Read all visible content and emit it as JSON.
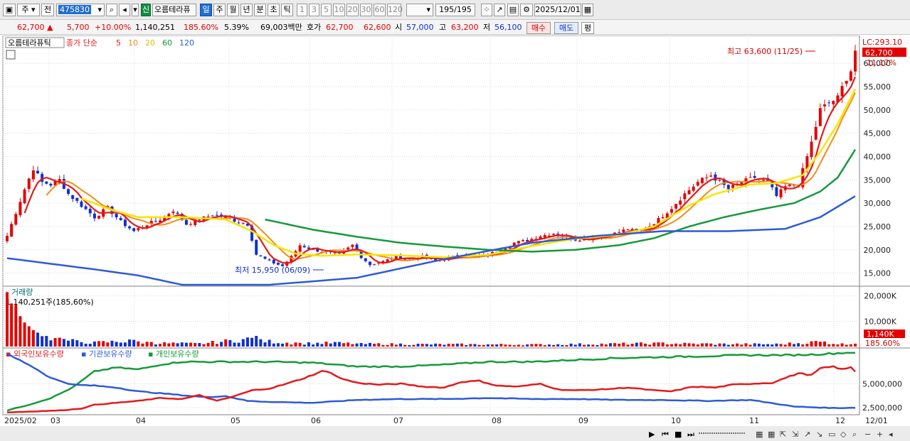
{
  "toolbar": {
    "period_type": "주",
    "scope": "전",
    "code": "475830",
    "badge": "신",
    "name": "오름테라퓨",
    "periods": [
      "일",
      "주",
      "월",
      "년",
      "분",
      "초",
      "틱"
    ],
    "active_period": "일",
    "intervals": [
      "1",
      "3",
      "5",
      "10",
      "20",
      "30",
      "60",
      "120"
    ],
    "count": "195/195",
    "date": "2025/12/01"
  },
  "quote": {
    "price": "62,700",
    "change": "5,700",
    "change_pct": "+10.00%",
    "volume": "1,140,251",
    "volume_ratio": "185.60%",
    "turnover": "5.39%",
    "value": "69,003백만",
    "hoga_label": "호가",
    "ask": "62,700",
    "bid": "62,600",
    "open_label": "시",
    "open": "57,000",
    "high_label": "고",
    "high": "63,200",
    "low_label": "저",
    "low": "56,100",
    "buy_label": "매수",
    "sell_label": "매도",
    "eval_label": "평"
  },
  "colors": {
    "up": "#e30000",
    "down": "#1030d0",
    "ma5": "#e31a1c",
    "ma10": "#f28c1b",
    "ma20": "#f5e600",
    "ma60": "#169a3a",
    "ma120": "#2e5bd6"
  },
  "chart_data": [
    {
      "type": "candlestick",
      "legend": {
        "name": "오름테라퓨틱",
        "label": "종가 단순",
        "periods": [
          "5",
          "10",
          "20",
          "60",
          "120"
        ]
      },
      "x_ticks": [
        "2025/02",
        "03",
        "04",
        "05",
        "06",
        "07",
        "08",
        "09",
        "10",
        "11",
        "12",
        "12/01"
      ],
      "y_ticks": [
        60000,
        55000,
        50000,
        45000,
        40000,
        35000,
        30000,
        25000,
        20000,
        15000
      ],
      "y_tick_labels": [
        "60,000",
        "55,000",
        "50,000",
        "45,000",
        "40,000",
        "35,000",
        "30,000",
        "25,000",
        "20,000",
        "15,000"
      ],
      "ylim": [
        12500,
        65500
      ],
      "lc_label": "LC:293.10",
      "last_price_label": "62,700",
      "last_pct_label": "11.17%",
      "annotations": {
        "high": "최고 63,600 (11/25)",
        "low": "최저 15,950 (06/09)"
      },
      "anchors": [
        [
          0,
          23000
        ],
        [
          2,
          28000
        ],
        [
          4,
          33000
        ],
        [
          6,
          37500
        ],
        [
          8,
          34500
        ],
        [
          10,
          34000
        ],
        [
          12,
          35000
        ],
        [
          14,
          32000
        ],
        [
          17,
          29500
        ],
        [
          20,
          27000
        ],
        [
          23,
          29000
        ],
        [
          26,
          26000
        ],
        [
          29,
          24000
        ],
        [
          32,
          25500
        ],
        [
          35,
          26500
        ],
        [
          38,
          28500
        ],
        [
          41,
          25500
        ],
        [
          44,
          26500
        ],
        [
          47,
          27500
        ],
        [
          50,
          27000
        ],
        [
          53,
          26000
        ],
        [
          55,
          25500
        ],
        [
          57,
          19000
        ],
        [
          60,
          17500
        ],
        [
          63,
          16500
        ],
        [
          65,
          18500
        ],
        [
          67,
          21000
        ],
        [
          70,
          20000
        ],
        [
          73,
          19500
        ],
        [
          76,
          19000
        ],
        [
          79,
          21000
        ],
        [
          81,
          18500
        ],
        [
          83,
          16800
        ],
        [
          86,
          17500
        ],
        [
          89,
          18500
        ],
        [
          92,
          18000
        ],
        [
          95,
          18500
        ],
        [
          98,
          17700
        ],
        [
          101,
          18200
        ],
        [
          104,
          19000
        ],
        [
          107,
          18500
        ],
        [
          110,
          19000
        ],
        [
          113,
          20000
        ],
        [
          116,
          21500
        ],
        [
          119,
          22000
        ],
        [
          122,
          23000
        ],
        [
          125,
          23500
        ],
        [
          128,
          22800
        ],
        [
          130,
          22200
        ],
        [
          133,
          22500
        ],
        [
          136,
          23000
        ],
        [
          139,
          23500
        ],
        [
          142,
          24500
        ],
        [
          144,
          23800
        ],
        [
          146,
          24500
        ],
        [
          149,
          26500
        ],
        [
          152,
          29000
        ],
        [
          155,
          32000
        ],
        [
          158,
          34500
        ],
        [
          161,
          36000
        ],
        [
          163,
          34500
        ],
        [
          165,
          33000
        ],
        [
          168,
          34500
        ],
        [
          171,
          35500
        ],
        [
          174,
          34500
        ],
        [
          176,
          31500
        ],
        [
          178,
          33500
        ],
        [
          181,
          34000
        ],
        [
          184,
          43000
        ],
        [
          186,
          50000
        ],
        [
          188,
          51500
        ],
        [
          190,
          52500
        ],
        [
          192,
          57000
        ],
        [
          193,
          58500
        ],
        [
          194,
          62700
        ]
      ],
      "ma_anchors": {
        "ma20": [
          [
            17,
            31000
          ],
          [
            24,
            28500
          ],
          [
            30,
            27000
          ],
          [
            40,
            27000
          ],
          [
            50,
            26500
          ],
          [
            56,
            24000
          ],
          [
            61,
            21000
          ],
          [
            66,
            19200
          ],
          [
            72,
            18700
          ],
          [
            80,
            19000
          ],
          [
            90,
            18800
          ],
          [
            100,
            18400
          ],
          [
            110,
            18900
          ],
          [
            120,
            20800
          ],
          [
            130,
            22400
          ],
          [
            140,
            23200
          ],
          [
            148,
            25000
          ],
          [
            156,
            29500
          ],
          [
            162,
            32000
          ],
          [
            170,
            34000
          ],
          [
            176,
            34300
          ],
          [
            182,
            36000
          ],
          [
            186,
            41000
          ],
          [
            190,
            47000
          ],
          [
            194,
            54500
          ]
        ],
        "ma60": [
          [
            59,
            26500
          ],
          [
            70,
            24300
          ],
          [
            80,
            22800
          ],
          [
            90,
            21500
          ],
          [
            100,
            20700
          ],
          [
            110,
            20000
          ],
          [
            120,
            19600
          ],
          [
            130,
            20000
          ],
          [
            140,
            21000
          ],
          [
            148,
            22500
          ],
          [
            156,
            25000
          ],
          [
            164,
            27000
          ],
          [
            172,
            28600
          ],
          [
            180,
            30000
          ],
          [
            186,
            32500
          ],
          [
            190,
            35500
          ],
          [
            194,
            41500
          ]
        ],
        "ma120": [
          [
            0,
            18200
          ],
          [
            10,
            17000
          ],
          [
            20,
            15800
          ],
          [
            30,
            14500
          ],
          [
            40,
            12500
          ],
          [
            60,
            12500
          ],
          [
            80,
            14000
          ],
          [
            100,
            18000
          ],
          [
            120,
            21500
          ],
          [
            135,
            23000
          ],
          [
            150,
            24000
          ],
          [
            165,
            24000
          ],
          [
            178,
            24500
          ],
          [
            186,
            27000
          ],
          [
            194,
            31500
          ]
        ]
      }
    },
    {
      "type": "bar",
      "title": "거래량",
      "label": "1,140,251주(185,60%)",
      "y_ticks": [
        20000,
        10000
      ],
      "y_tick_labels": [
        "20,000K",
        "10,000K"
      ],
      "last_label": "1,140K",
      "last_pct": "185.60%",
      "ylim": [
        0,
        23000
      ],
      "peaks": [
        [
          0,
          21500
        ],
        [
          1,
          17000
        ],
        [
          2,
          16500
        ],
        [
          3,
          12000
        ],
        [
          4,
          9500
        ],
        [
          5,
          8000
        ],
        [
          6,
          6500
        ],
        [
          7,
          5500
        ],
        [
          9,
          4200
        ],
        [
          12,
          3500
        ],
        [
          16,
          2500
        ],
        [
          20,
          2000
        ],
        [
          28,
          2800
        ],
        [
          33,
          1800
        ],
        [
          44,
          1400
        ],
        [
          57,
          4200
        ],
        [
          58,
          2900
        ],
        [
          66,
          1600
        ],
        [
          75,
          1800
        ],
        [
          81,
          1400
        ],
        [
          90,
          1200
        ],
        [
          120,
          1000
        ],
        [
          150,
          1600
        ],
        [
          160,
          1300
        ],
        [
          176,
          1200
        ],
        [
          185,
          2200
        ],
        [
          187,
          2000
        ],
        [
          193,
          900
        ],
        [
          194,
          1140
        ]
      ]
    },
    {
      "type": "line",
      "series": [
        {
          "name": "외국인보유수량",
          "color": "#e31a1c"
        },
        {
          "name": "기관보유수량",
          "color": "#2e5bd6"
        },
        {
          "name": "개인보유수량",
          "color": "#169a3a"
        }
      ],
      "y_ticks": [
        5000000,
        2500000
      ],
      "y_tick_labels": [
        "5,000,000",
        "2,500,000"
      ],
      "ylim": [
        1900000,
        8600000
      ],
      "red": [
        [
          0,
          2000000
        ],
        [
          6,
          2100000
        ],
        [
          12,
          2200000
        ],
        [
          17,
          2400000
        ],
        [
          20,
          2800000
        ],
        [
          25,
          3000000
        ],
        [
          30,
          3200000
        ],
        [
          35,
          3500000
        ],
        [
          40,
          3400000
        ],
        [
          44,
          3800000
        ],
        [
          48,
          3200000
        ],
        [
          52,
          3700000
        ],
        [
          56,
          4300000
        ],
        [
          60,
          4500000
        ],
        [
          64,
          5000000
        ],
        [
          68,
          5600000
        ],
        [
          72,
          6300000
        ],
        [
          74,
          6200000
        ],
        [
          76,
          5600000
        ],
        [
          80,
          5100000
        ],
        [
          85,
          4900000
        ],
        [
          90,
          5000000
        ],
        [
          95,
          4700000
        ],
        [
          100,
          4600000
        ],
        [
          104,
          5200000
        ],
        [
          108,
          5300000
        ],
        [
          112,
          4800000
        ],
        [
          117,
          4700000
        ],
        [
          122,
          5000000
        ],
        [
          126,
          4400000
        ],
        [
          130,
          4300000
        ],
        [
          136,
          4400000
        ],
        [
          142,
          4600000
        ],
        [
          148,
          4300000
        ],
        [
          152,
          4200000
        ],
        [
          157,
          4700000
        ],
        [
          162,
          4600000
        ],
        [
          166,
          4900000
        ],
        [
          170,
          5000000
        ],
        [
          175,
          5100000
        ],
        [
          178,
          5600000
        ],
        [
          181,
          6100000
        ],
        [
          184,
          5900000
        ],
        [
          186,
          6600000
        ],
        [
          189,
          6800000
        ],
        [
          191,
          6500000
        ],
        [
          193,
          6700000
        ],
        [
          194,
          6300000
        ]
      ],
      "blue": [
        [
          0,
          8100000
        ],
        [
          5,
          7000000
        ],
        [
          10,
          5600000
        ],
        [
          15,
          4900000
        ],
        [
          20,
          4800000
        ],
        [
          25,
          4600000
        ],
        [
          30,
          4200000
        ],
        [
          35,
          4000000
        ],
        [
          40,
          3800000
        ],
        [
          45,
          3600000
        ],
        [
          50,
          3700000
        ],
        [
          55,
          3200000
        ],
        [
          60,
          3100000
        ],
        [
          70,
          3000000
        ],
        [
          80,
          3300000
        ],
        [
          90,
          3400000
        ],
        [
          100,
          3400000
        ],
        [
          110,
          3500000
        ],
        [
          120,
          3400000
        ],
        [
          130,
          3400000
        ],
        [
          140,
          3300000
        ],
        [
          150,
          3300000
        ],
        [
          160,
          3200000
        ],
        [
          170,
          3300000
        ],
        [
          176,
          2900000
        ],
        [
          180,
          2600000
        ],
        [
          186,
          2500000
        ],
        [
          190,
          2450000
        ],
        [
          194,
          2500000
        ]
      ],
      "green": [
        [
          0,
          2200000
        ],
        [
          5,
          2800000
        ],
        [
          10,
          3500000
        ],
        [
          15,
          4600000
        ],
        [
          20,
          6300000
        ],
        [
          25,
          6700000
        ],
        [
          30,
          6500000
        ],
        [
          35,
          7000000
        ],
        [
          40,
          7300000
        ],
        [
          50,
          7300000
        ],
        [
          60,
          7300000
        ],
        [
          70,
          7200000
        ],
        [
          80,
          6800000
        ],
        [
          90,
          6800000
        ],
        [
          100,
          7000000
        ],
        [
          110,
          7300000
        ],
        [
          120,
          7300000
        ],
        [
          130,
          7500000
        ],
        [
          140,
          7700000
        ],
        [
          150,
          7800000
        ],
        [
          160,
          7900000
        ],
        [
          170,
          8000000
        ],
        [
          180,
          8000000
        ],
        [
          186,
          8100000
        ],
        [
          190,
          8200000
        ],
        [
          194,
          8300000
        ]
      ]
    }
  ]
}
